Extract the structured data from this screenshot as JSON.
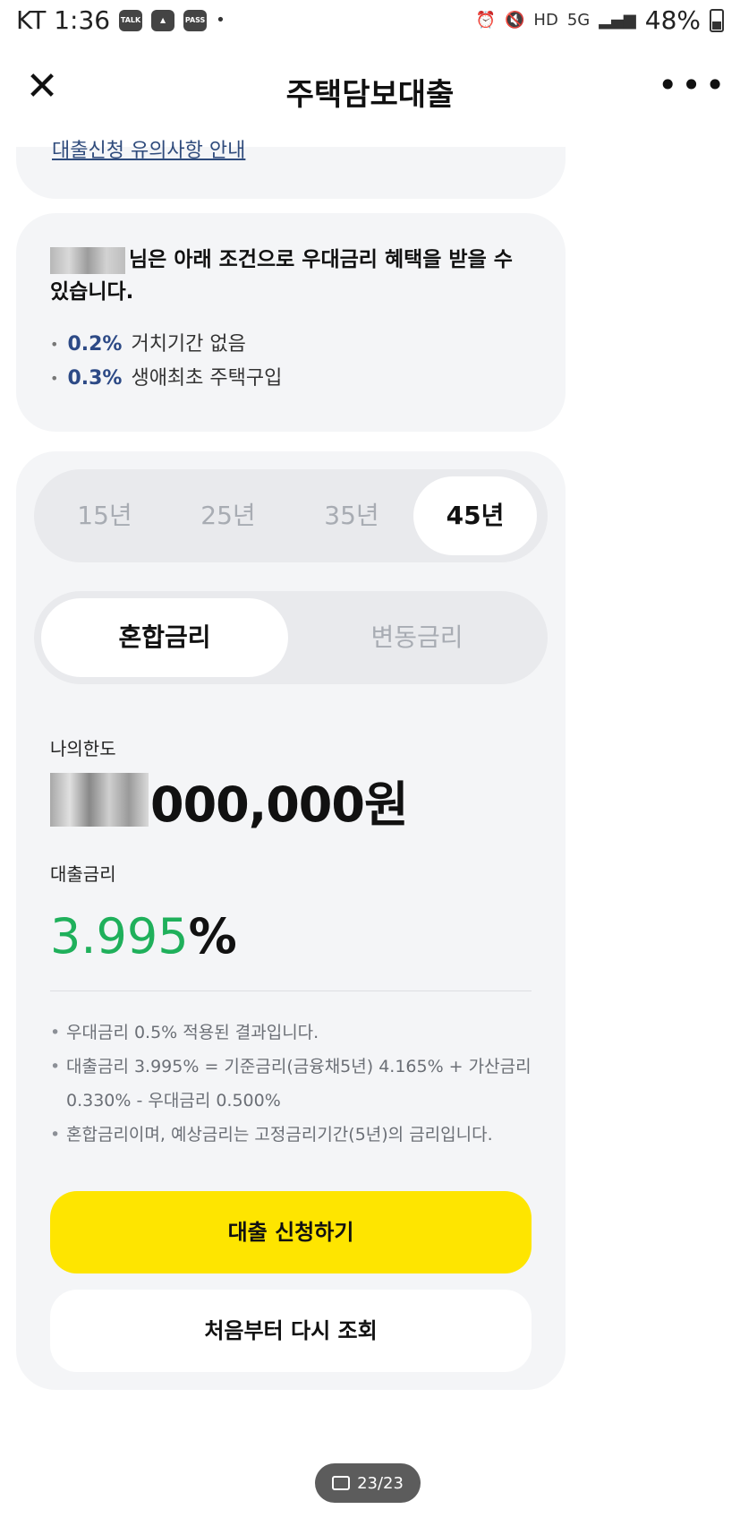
{
  "status_bar": {
    "carrier_time": "KT 1:36",
    "icons_left": [
      "TALK",
      "",
      "PASS"
    ],
    "dot": "•",
    "network": "5G",
    "battery": "48%"
  },
  "header": {
    "title": "주택담보대출",
    "close_glyph": "✕",
    "more_glyph": "•••"
  },
  "top_card": {
    "link_text": "대출신청 유의사항 안내"
  },
  "benefit": {
    "message": "님은 아래 조건으로 우대금리 혜택을 받을 수 있습니다.",
    "items": [
      {
        "rate": "0.2%",
        "label": "거치기간 없음"
      },
      {
        "rate": "0.3%",
        "label": "생애최초 주택구입"
      }
    ]
  },
  "loan": {
    "years": [
      "15년",
      "25년",
      "35년",
      "45년"
    ],
    "selected_year": "45년",
    "rate_types": [
      "혼합금리",
      "변동금리"
    ],
    "selected_rate_type": "혼합금리",
    "limit_label": "나의한도",
    "limit_amount": "000,000원",
    "rate_label": "대출금리",
    "rate_value": "3.995",
    "rate_unit": "%",
    "notes": [
      "우대금리 0.5% 적용된 결과입니다.",
      "대출금리 3.995% = 기준금리(금융채5년) 4.165% + 가산금리 0.330% - 우대금리 0.500%",
      "혼합금리이며, 예상금리는 고정금리기간(5년)의 금리입니다."
    ],
    "apply_button": "대출 신청하기",
    "restart_button": "처음부터 다시 조회"
  },
  "pager": {
    "text": "23/23"
  }
}
